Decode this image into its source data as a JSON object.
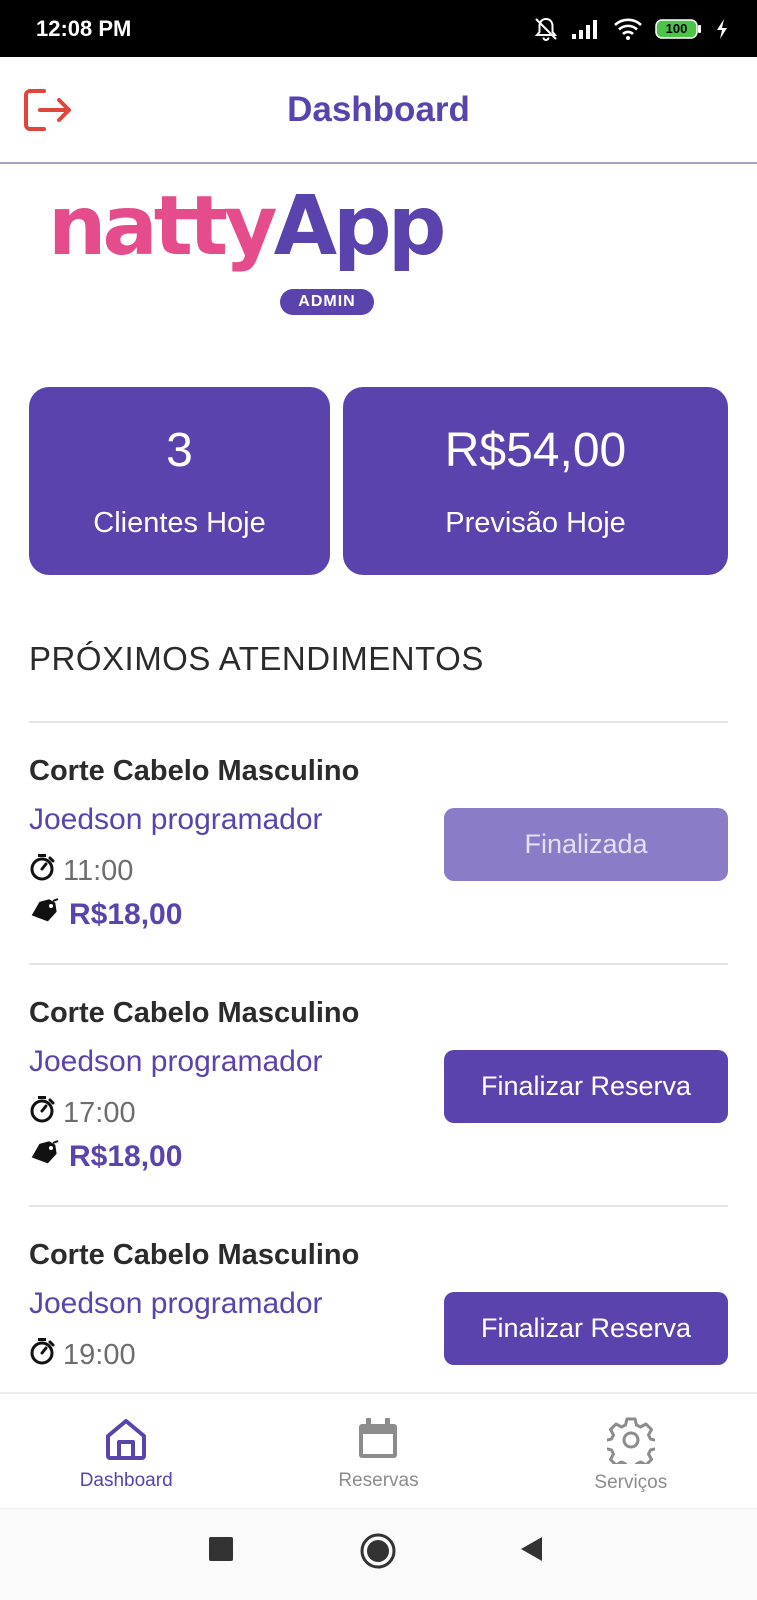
{
  "status_bar": {
    "time": "12:08 PM",
    "battery": "100"
  },
  "header": {
    "title": "Dashboard"
  },
  "logo": {
    "word_pink": "natty",
    "word_purple": "App",
    "badge": "ADMIN"
  },
  "stats": {
    "clients_value": "3",
    "clients_label": "Clientes Hoje",
    "forecast_value": "R$54,00",
    "forecast_label": "Previsão Hoje"
  },
  "section_title": "PRÓXIMOS ATENDIMENTOS",
  "appointments": [
    {
      "service": "Corte Cabelo Masculino",
      "client": "Joedson programador",
      "time": "11:00",
      "price": "R$18,00",
      "button": "Finalizada"
    },
    {
      "service": "Corte Cabelo Masculino",
      "client": "Joedson programador",
      "time": "17:00",
      "price": "R$18,00",
      "button": "Finalizar Reserva"
    },
    {
      "service": "Corte Cabelo Masculino",
      "client": "Joedson programador",
      "time": "19:00",
      "button": "Finalizar Reserva"
    }
  ],
  "bottom_nav": {
    "items": [
      {
        "label": "Dashboard",
        "icon": "home-icon",
        "active": true
      },
      {
        "label": "Reservas",
        "icon": "calendar-icon",
        "active": false
      },
      {
        "label": "Serviços",
        "icon": "gear-icon",
        "active": false
      }
    ]
  },
  "colors": {
    "primary": "#5a43ad",
    "primary_disabled": "#8b7cc8",
    "brand_pink": "#e54c8b",
    "logout_red": "#e2453c"
  }
}
